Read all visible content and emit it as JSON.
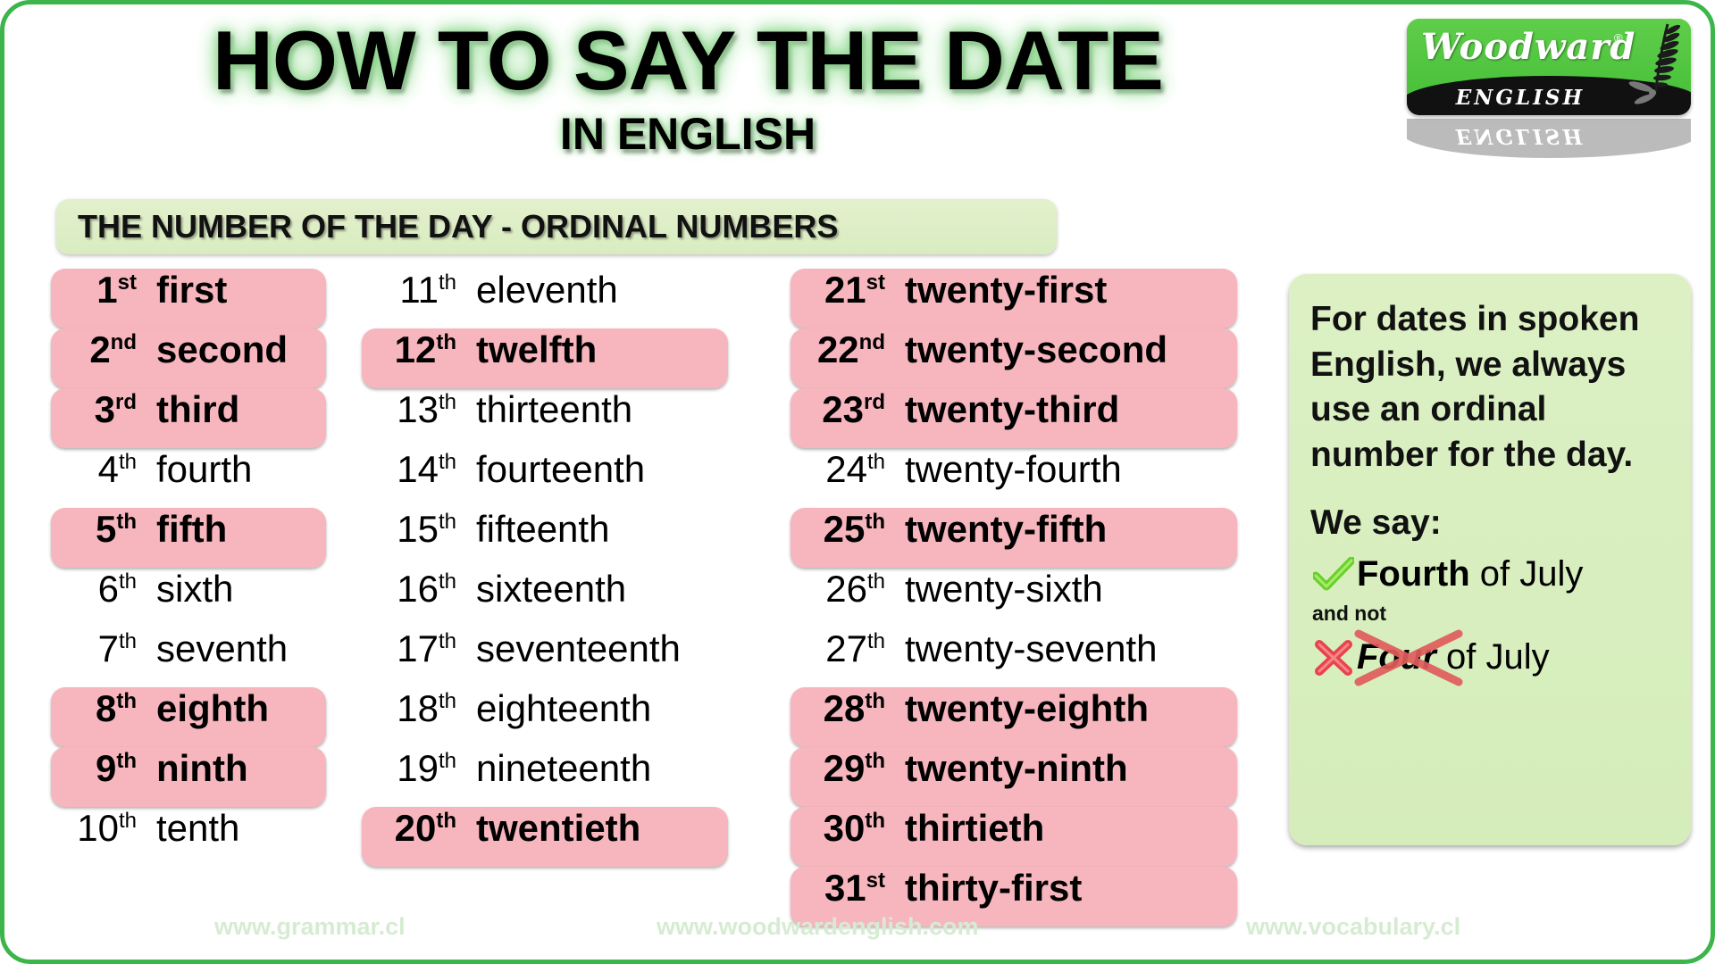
{
  "header": {
    "title": "HOW TO SAY THE DATE",
    "subtitle": "IN ENGLISH"
  },
  "logo": {
    "brand": "Woodward",
    "registered": "®",
    "sub": "ENGLISH",
    "reflection": "ENGLISH",
    "green": "#4cc23f"
  },
  "section": {
    "banner": "THE NUMBER OF THE DAY - ORDINAL NUMBERS"
  },
  "colors": {
    "border_green": "#3cb54a",
    "banner_green": "#dfeec7",
    "highlight_pink": "#f7b6be",
    "note_green": "#d9eec0",
    "check_green": "#67d02b",
    "cross_red": "#e8434a",
    "footer_text": "#d6ecd2"
  },
  "columns": [
    {
      "name": "column-1",
      "rows": [
        {
          "num": "1",
          "suffix": "st",
          "word": "first",
          "highlight": true
        },
        {
          "num": "2",
          "suffix": "nd",
          "word": "second",
          "highlight": true
        },
        {
          "num": "3",
          "suffix": "rd",
          "word": "third",
          "highlight": true
        },
        {
          "num": "4",
          "suffix": "th",
          "word": "fourth",
          "highlight": false
        },
        {
          "num": "5",
          "suffix": "th",
          "word": "fifth",
          "highlight": true
        },
        {
          "num": "6",
          "suffix": "th",
          "word": "sixth",
          "highlight": false
        },
        {
          "num": "7",
          "suffix": "th",
          "word": "seventh",
          "highlight": false
        },
        {
          "num": "8",
          "suffix": "th",
          "word": "eighth",
          "highlight": true
        },
        {
          "num": "9",
          "suffix": "th",
          "word": "ninth",
          "highlight": true
        },
        {
          "num": "10",
          "suffix": "th",
          "word": "tenth",
          "highlight": false
        }
      ]
    },
    {
      "name": "column-2",
      "rows": [
        {
          "num": "11",
          "suffix": "th",
          "word": "eleventh",
          "highlight": false
        },
        {
          "num": "12",
          "suffix": "th",
          "word": "twelfth",
          "highlight": true
        },
        {
          "num": "13",
          "suffix": "th",
          "word": "thirteenth",
          "highlight": false
        },
        {
          "num": "14",
          "suffix": "th",
          "word": "fourteenth",
          "highlight": false
        },
        {
          "num": "15",
          "suffix": "th",
          "word": "fifteenth",
          "highlight": false
        },
        {
          "num": "16",
          "suffix": "th",
          "word": "sixteenth",
          "highlight": false
        },
        {
          "num": "17",
          "suffix": "th",
          "word": "seventeenth",
          "highlight": false
        },
        {
          "num": "18",
          "suffix": "th",
          "word": "eighteenth",
          "highlight": false
        },
        {
          "num": "19",
          "suffix": "th",
          "word": "nineteenth",
          "highlight": false
        },
        {
          "num": "20",
          "suffix": "th",
          "word": "twentieth",
          "highlight": true
        }
      ]
    },
    {
      "name": "column-3",
      "rows": [
        {
          "num": "21",
          "suffix": "st",
          "word": "twenty-first",
          "highlight": true
        },
        {
          "num": "22",
          "suffix": "nd",
          "word": "twenty-second",
          "highlight": true
        },
        {
          "num": "23",
          "suffix": "rd",
          "word": "twenty-third",
          "highlight": true
        },
        {
          "num": "24",
          "suffix": "th",
          "word": "twenty-fourth",
          "highlight": false
        },
        {
          "num": "25",
          "suffix": "th",
          "word": "twenty-fifth",
          "highlight": true
        },
        {
          "num": "26",
          "suffix": "th",
          "word": "twenty-sixth",
          "highlight": false
        },
        {
          "num": "27",
          "suffix": "th",
          "word": "twenty-seventh",
          "highlight": false
        },
        {
          "num": "28",
          "suffix": "th",
          "word": "twenty-eighth",
          "highlight": true
        },
        {
          "num": "29",
          "suffix": "th",
          "word": "twenty-ninth",
          "highlight": true
        },
        {
          "num": "30",
          "suffix": "th",
          "word": "thirtieth",
          "highlight": true
        },
        {
          "num": "31",
          "suffix": "st",
          "word": "thirty-first",
          "highlight": true
        }
      ]
    }
  ],
  "note": {
    "paragraph": "For dates in spoken English, we always use an ordinal number for the day.",
    "we_say": "We say:",
    "correct_bold": "Fourth",
    "correct_rest": " of July",
    "and_not": "and not",
    "wrong_bold": "Four",
    "wrong_rest": " of July",
    "check_icon": "check-mark-icon",
    "cross_icon": "cross-mark-icon"
  },
  "footer": {
    "url1": "www.grammar.cl",
    "url2": "www.woodwardenglish.com",
    "url3": "www.vocabulary.cl"
  }
}
